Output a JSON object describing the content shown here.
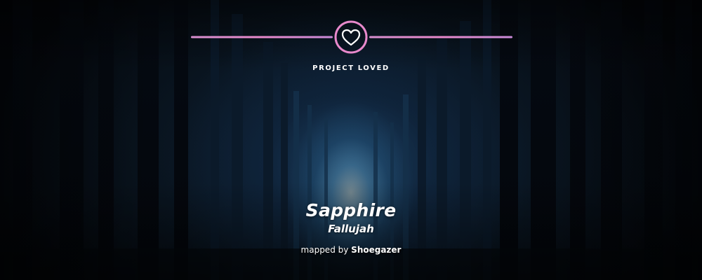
{
  "banner": {
    "brand_label": "PROJECT LOVED",
    "emblem_icon": "heart-icon",
    "title": "Sapphire",
    "artist": "Fallujah",
    "mapped_by_prefix": "mapped by",
    "mapper": "Shoegazer"
  },
  "colors": {
    "accent_pink": "#e889cc",
    "accent_violet": "#b98ad8",
    "text": "#ffffff"
  }
}
